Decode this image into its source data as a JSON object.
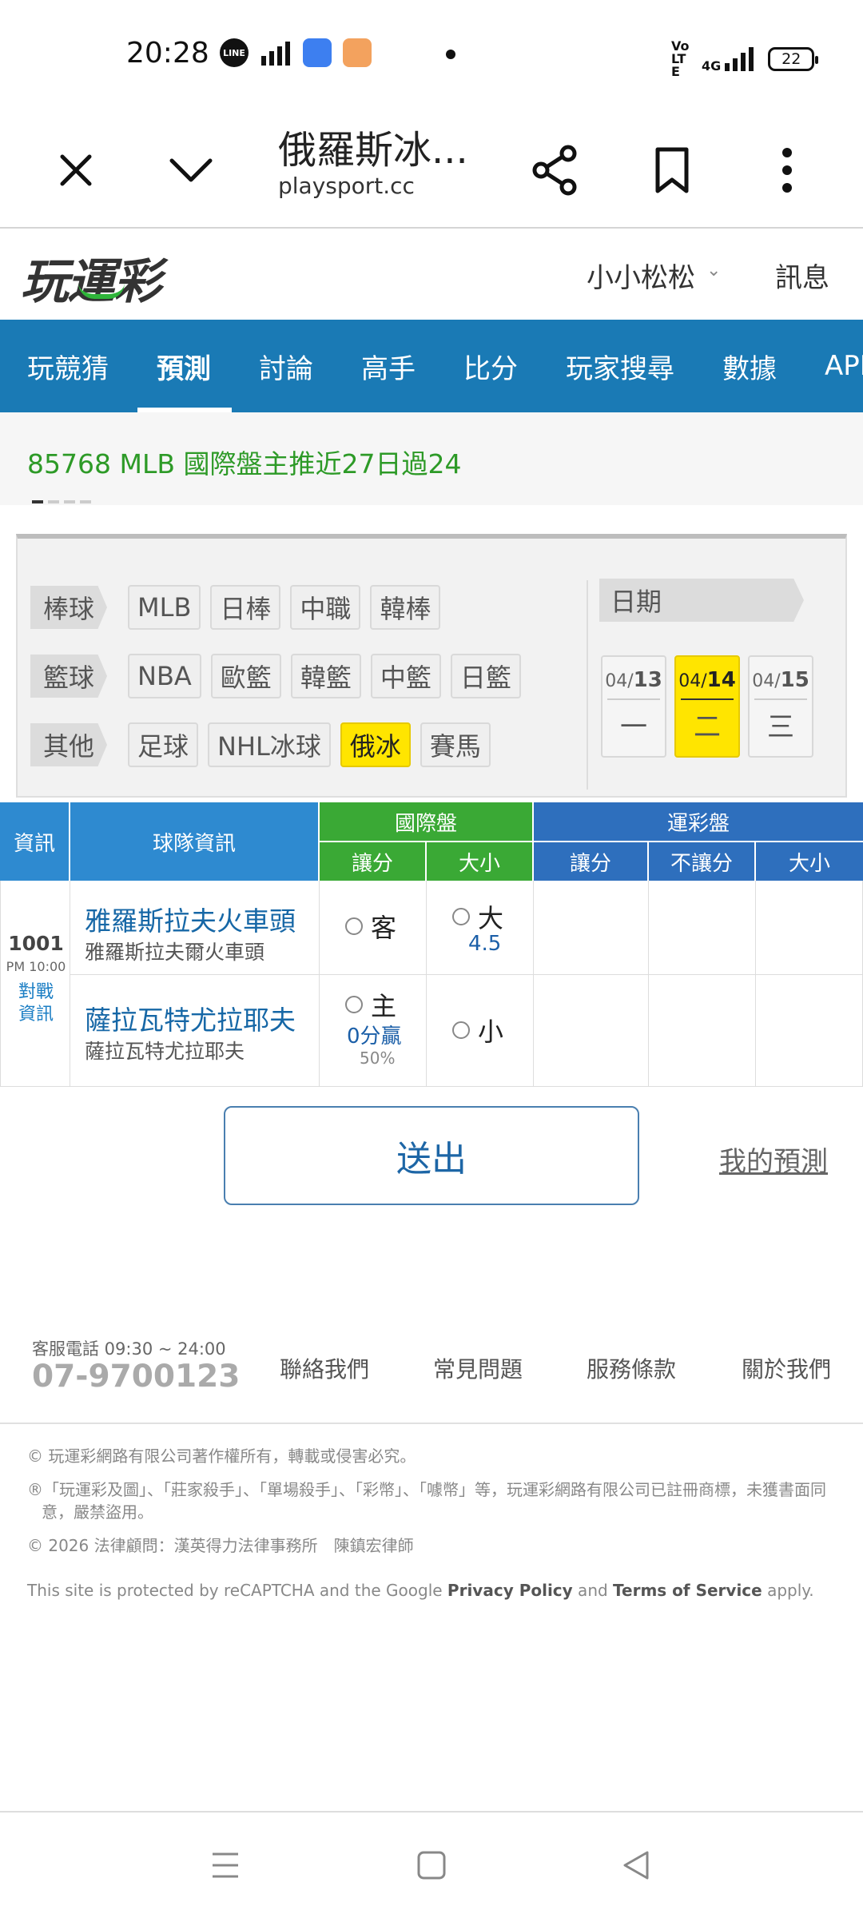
{
  "status": {
    "time": "20:28",
    "battery": "22",
    "volte": "Vo LTE",
    "network": "4G"
  },
  "browser": {
    "title": "俄羅斯冰...",
    "url": "playsport.cc"
  },
  "site": {
    "logo": "玩運彩",
    "user": "小小松松",
    "messages": "訊息"
  },
  "nav": [
    "玩競猜",
    "預測",
    "討論",
    "高手",
    "比分",
    "玩家搜尋",
    "數據",
    "APP"
  ],
  "marquee": "85768  MLB 國際盤主推近27日過24",
  "filters": {
    "rows": [
      {
        "cat": "棒球",
        "items": [
          "MLB",
          "日棒",
          "中職",
          "韓棒"
        ]
      },
      {
        "cat": "籃球",
        "items": [
          "NBA",
          "歐籃",
          "韓籃",
          "中籃",
          "日籃"
        ]
      },
      {
        "cat": "其他",
        "items": [
          "足球",
          "NHL冰球",
          "俄冰",
          "賽馬"
        ]
      }
    ],
    "selected": "俄冰",
    "date_label": "日期",
    "dates": [
      {
        "m": "04/",
        "d": "13",
        "day": "一"
      },
      {
        "m": "04/",
        "d": "14",
        "day": "二"
      },
      {
        "m": "04/",
        "d": "15",
        "day": "三"
      }
    ],
    "selected_date": "14"
  },
  "table": {
    "h_info": "資訊",
    "h_team": "球隊資訊",
    "h_intl": "國際盤",
    "h_lottery": "運彩盤",
    "h_spread": "讓分",
    "h_total": "大小",
    "h_l_spread": "讓分",
    "h_l_nospread": "不讓分",
    "h_l_total": "大小",
    "game": {
      "id": "1001",
      "time": "PM 10:00",
      "link": "對戰資訊",
      "away": {
        "name": "雅羅斯拉夫火車頭",
        "sub": "雅羅斯拉夫爾火車頭",
        "spread_label": "客",
        "total_label": "大",
        "total_value": "4.5"
      },
      "home": {
        "name": "薩拉瓦特尤拉耶夫",
        "sub": "薩拉瓦特尤拉耶夫",
        "spread_label": "主",
        "spread_value": "0分贏",
        "spread_pct": "50%",
        "total_label": "小"
      }
    }
  },
  "actions": {
    "submit": "送出",
    "my_predictions": "我的預測"
  },
  "footer": {
    "service": "客服電話 09:30 ~ 24:00",
    "phone": "07-9700123",
    "links": [
      "聯絡我們",
      "常見問題",
      "服務條款",
      "關於我們"
    ],
    "copyright": "© 玩運彩網路有限公司著作權所有，轉載或侵害必究。",
    "trademark": "®「玩運彩及圖」、「莊家殺手」、「單場殺手」、「彩幣」、「噱幣」等，玩運彩網路有限公司已註冊商標，未獲書面同意，嚴禁盜用。",
    "legal": "© 2026 法律顧問：漢英得力法律事務所　陳鎮宏律師",
    "recaptcha_pre": "This site is protected by reCAPTCHA and the Google ",
    "privacy": "Privacy Policy",
    "and": " and ",
    "terms": "Terms of Service",
    "apply": " apply."
  }
}
